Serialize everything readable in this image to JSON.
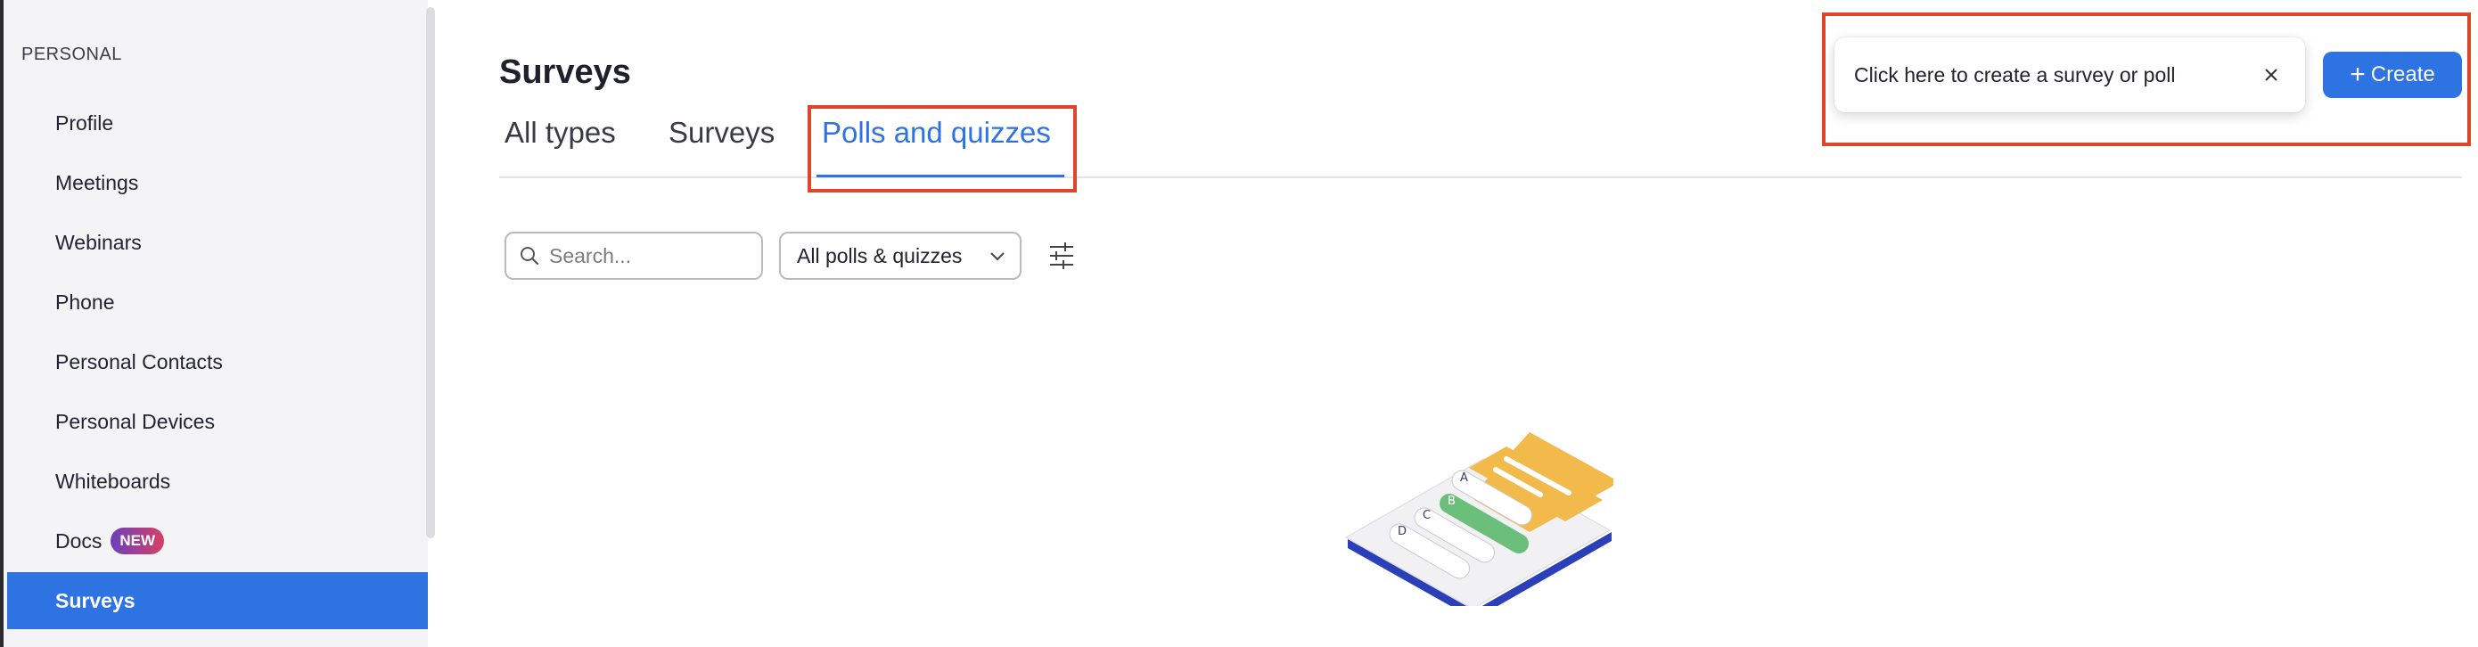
{
  "sidebar": {
    "section_label": "PERSONAL",
    "items": [
      {
        "label": "Profile"
      },
      {
        "label": "Meetings"
      },
      {
        "label": "Webinars"
      },
      {
        "label": "Phone"
      },
      {
        "label": "Personal Contacts"
      },
      {
        "label": "Personal Devices"
      },
      {
        "label": "Whiteboards"
      },
      {
        "label": "Docs",
        "badge": "NEW"
      },
      {
        "label": "Surveys",
        "active": true
      }
    ]
  },
  "main": {
    "title": "Surveys",
    "tabs": [
      {
        "label": "All types"
      },
      {
        "label": "Surveys"
      },
      {
        "label": "Polls and quizzes",
        "active": true
      }
    ],
    "search": {
      "placeholder": "Search..."
    },
    "filter": {
      "selected": "All polls & quizzes",
      "icon": "chevron-down-icon"
    },
    "filter_settings_icon": "sliders-icon"
  },
  "tooltip": {
    "text": "Click here to create a survey or poll",
    "close_icon": "close-icon"
  },
  "create_button": {
    "label": "Create",
    "icon": "plus-icon"
  },
  "illustration": {
    "options": [
      "A",
      "B",
      "C",
      "D"
    ]
  },
  "colors": {
    "accent": "#2d73e2",
    "highlight_box": "#e0442c",
    "sidebar_bg": "#f4f4f6",
    "badge_gradient": [
      "#6b3fbf",
      "#d64063"
    ],
    "illustration_yellow": "#f2b94b",
    "illustration_green": "#6bbf7a"
  }
}
